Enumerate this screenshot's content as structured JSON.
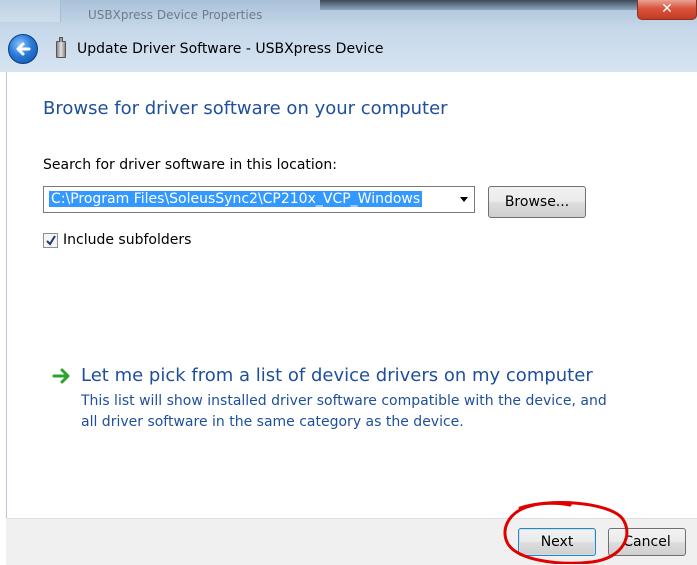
{
  "background_window": {
    "title": "USBXpress Device Properties"
  },
  "window": {
    "close_glyph": "✕",
    "title": "Update Driver Software - USBXpress Device"
  },
  "main": {
    "heading": "Browse for driver software on your computer",
    "search_label": "Search for driver software in this location:",
    "path_value": "C:\\Program Files\\SoleusSync2\\CP210x_VCP_Windows",
    "browse_label": "Browse...",
    "include_subfolders_label": "Include subfolders",
    "include_subfolders_checked": true,
    "pick_title": "Let me pick from a list of device drivers on my computer",
    "pick_description": "This list will show installed driver software compatible with the device, and all driver software in the same category as the device."
  },
  "footer": {
    "next_label": "Next",
    "cancel_label": "Cancel"
  },
  "colors": {
    "heading": "#1e4f9c",
    "selection": "#3399ff",
    "annotation": "#e00000",
    "link_arrow": "#2ea12e"
  },
  "icons": {
    "back": "back-arrow-icon",
    "device": "usb-device-icon",
    "link": "green-arrow-icon",
    "checkbox": "checkmark-icon"
  }
}
